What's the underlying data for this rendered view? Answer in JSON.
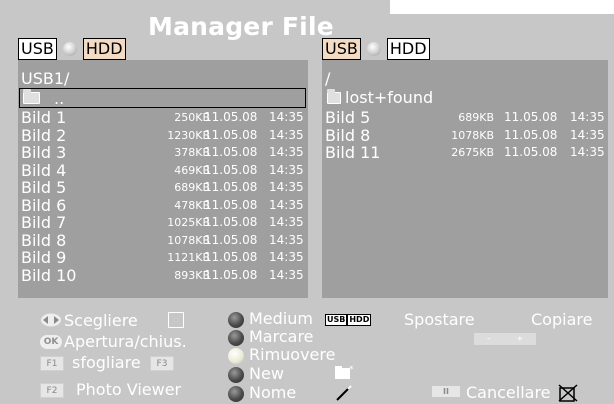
{
  "header": {
    "title": "Manager File"
  },
  "source_toggles": {
    "left": {
      "usb_label": "USB",
      "hdd_label": "HDD",
      "active": "HDD"
    },
    "right": {
      "usb_label": "USB",
      "hdd_label": "HDD",
      "active": "USB"
    }
  },
  "left_panel": {
    "path": "USB1/",
    "parent_label": "..",
    "files": [
      {
        "name": "Bild 1",
        "size": "250KB",
        "date": "11.05.08",
        "time": "14:35"
      },
      {
        "name": "Bild 2",
        "size": "1230KB",
        "date": "11.05.08",
        "time": "14:35"
      },
      {
        "name": "Bild 3",
        "size": "378KB",
        "date": "11.05.08",
        "time": "14:35"
      },
      {
        "name": "Bild 4",
        "size": "469KB",
        "date": "11.05.08",
        "time": "14:35"
      },
      {
        "name": "Bild 5",
        "size": "689KB",
        "date": "11.05.08",
        "time": "14:35"
      },
      {
        "name": "Bild 6",
        "size": "478KB",
        "date": "11.05.08",
        "time": "14:35"
      },
      {
        "name": "Bild 7",
        "size": "1025KB",
        "date": "11.05.08",
        "time": "14:35"
      },
      {
        "name": "Bild 8",
        "size": "1078KB",
        "date": "11.05.08",
        "time": "14:35"
      },
      {
        "name": "Bild 9",
        "size": "1121KB",
        "date": "11.05.08",
        "time": "14:35"
      },
      {
        "name": "Bild 10",
        "size": "893KB",
        "date": "11.05.08",
        "time": "14:35"
      }
    ]
  },
  "right_panel": {
    "path": "/",
    "folder_label": "lost+found",
    "files": [
      {
        "name": "Bild 5",
        "size": "689KB",
        "date": "11.05.08",
        "time": "14:35"
      },
      {
        "name": "Bild 8",
        "size": "1078KB",
        "date": "11.05.08",
        "time": "14:35"
      },
      {
        "name": "Bild 11",
        "size": "2675KB",
        "date": "11.05.08",
        "time": "14:35"
      }
    ]
  },
  "footer": {
    "select_label": "Scegliere",
    "open_close_label": "Apertura/chius.",
    "ok_key": "OK",
    "f1_key": "F1",
    "browse_label": "sfogliare",
    "f3_key": "F3",
    "f2_key": "F2",
    "photo_viewer_label": "Photo Viewer",
    "medium_label": "Medium",
    "mark_label": "Marcare",
    "remove_label": "Rimuovere",
    "new_label": "New",
    "name_label": "Nome",
    "mini_usb": "USB",
    "mini_hdd": "HDD",
    "move_label": "Spostare",
    "copy_label": "Copiare",
    "minus": "–",
    "plus": "+",
    "pause_key": "II",
    "delete_label": "Cancellare"
  }
}
